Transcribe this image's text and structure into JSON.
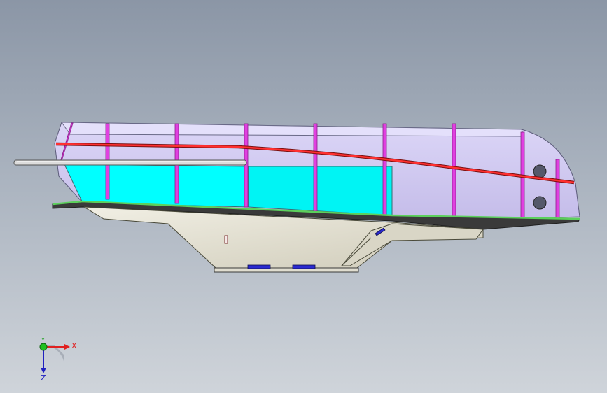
{
  "triad": {
    "x_label": "X",
    "y_label": "Y",
    "z_label": "Z",
    "x_color": "#e02020",
    "y_color": "#20a020",
    "z_color": "#2020c0"
  },
  "colors": {
    "background_top": "#8b96a6",
    "background_bottom": "#cfd4da",
    "deck_frame": "#cfc8ef",
    "tank_fill": "#00ffff",
    "ribs": "#e040e0",
    "sheer_line": "#e02a2a",
    "deck_plate": "#4fc04f",
    "keel_body": "#e8e6d8",
    "keel_pads": "#2a2ad0"
  }
}
